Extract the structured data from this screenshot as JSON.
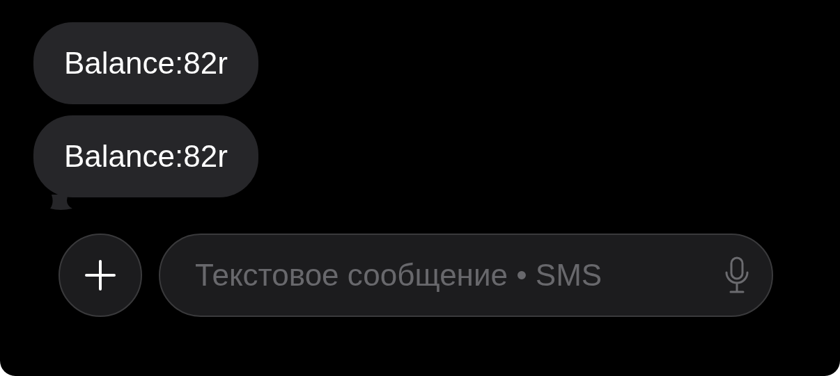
{
  "messages": [
    {
      "text": "Balance:82r",
      "tail": false
    },
    {
      "text": "Balance:82r",
      "tail": true
    }
  ],
  "composer": {
    "placeholder": "Текстовое сообщение • SMS"
  }
}
